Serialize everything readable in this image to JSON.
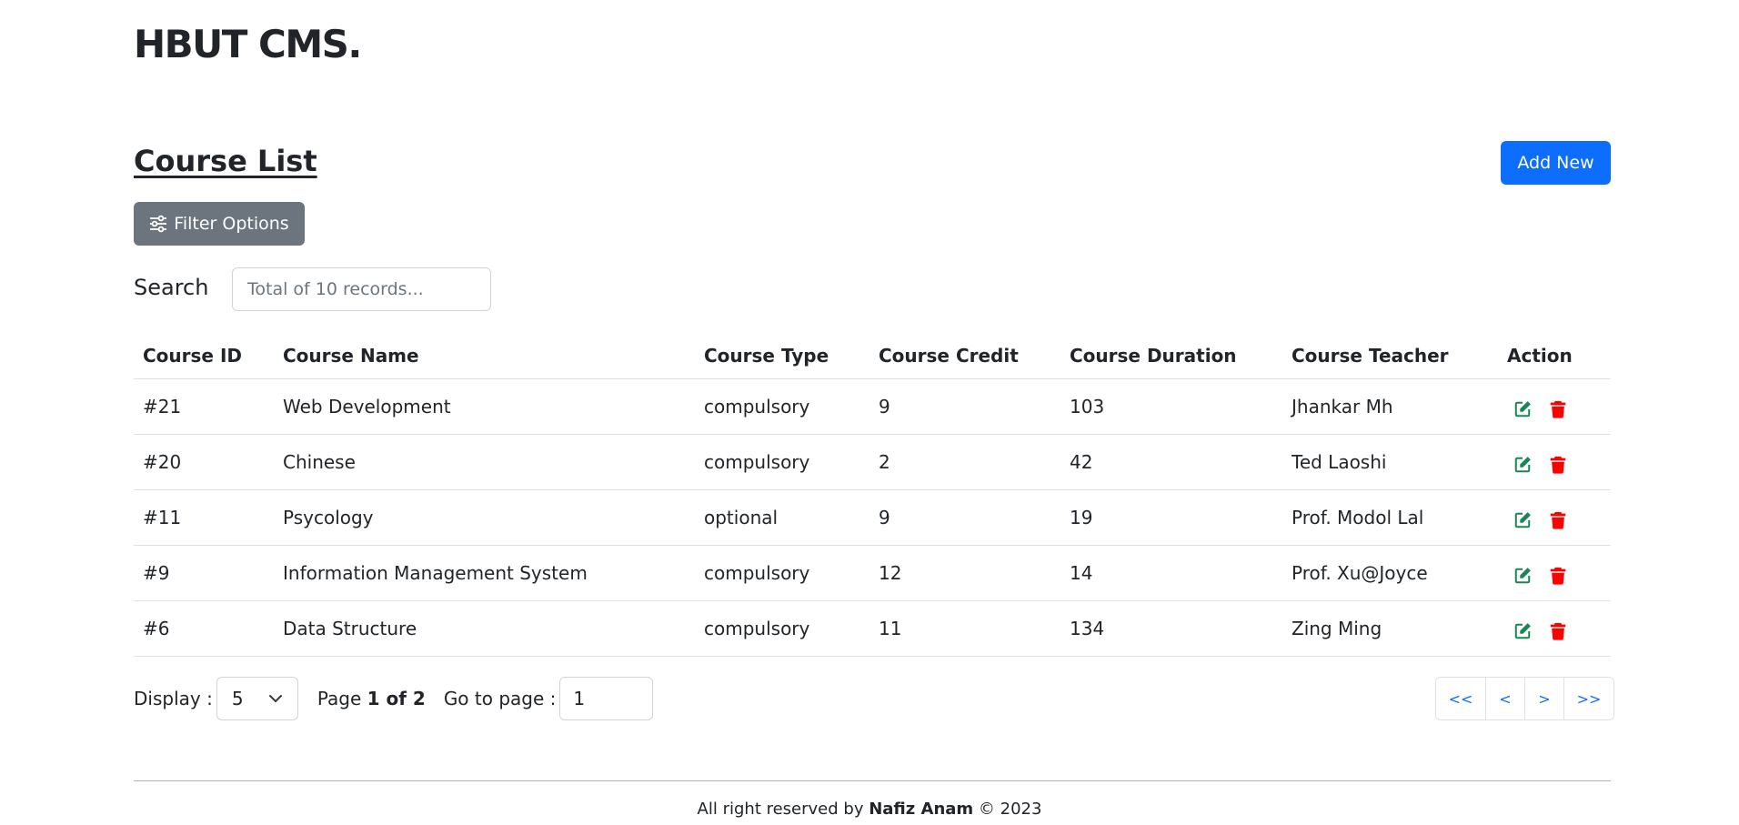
{
  "header": {
    "brand": "HBUT CMS."
  },
  "page": {
    "title": "Course List",
    "add_button": "Add New",
    "filter_button": "Filter Options"
  },
  "search": {
    "label": "Search",
    "placeholder": "Total of 10 records..."
  },
  "table": {
    "columns": [
      "Course ID",
      "Course Name",
      "Course Type",
      "Course Credit",
      "Course Duration",
      "Course Teacher",
      "Action"
    ],
    "rows": [
      {
        "id": "#21",
        "name": "Web Development",
        "type": "compulsory",
        "credit": "9",
        "duration": "103",
        "teacher": "Jhankar Mh"
      },
      {
        "id": "#20",
        "name": "Chinese",
        "type": "compulsory",
        "credit": "2",
        "duration": "42",
        "teacher": "Ted Laoshi"
      },
      {
        "id": "#11",
        "name": "Psycology",
        "type": "optional",
        "credit": "9",
        "duration": "19",
        "teacher": "Prof. Modol Lal"
      },
      {
        "id": "#9",
        "name": "Information Management System",
        "type": "compulsory",
        "credit": "12",
        "duration": "14",
        "teacher": "Prof. Xu@Joyce"
      },
      {
        "id": "#6",
        "name": "Data Structure",
        "type": "compulsory",
        "credit": "11",
        "duration": "134",
        "teacher": "Zing Ming"
      }
    ],
    "icons": {
      "edit": "edit-icon",
      "delete": "trash-icon"
    },
    "colors": {
      "edit": "#198754",
      "delete": "#dc3545"
    }
  },
  "pagination": {
    "display_label": "Display :",
    "display_value": "5",
    "page_prefix": "Page",
    "page_current": "1 of 2",
    "goto_label": "Go to page :",
    "goto_value": "1",
    "first": "<<",
    "prev": "<",
    "next": ">",
    "last": ">>"
  },
  "footer": {
    "prefix": "All right reserved by",
    "author": "Nafiz Anam",
    "copyright_symbol": "©",
    "year": "2023"
  },
  "colors": {
    "primary": "#0d6efd",
    "secondary": "#6c757d"
  }
}
